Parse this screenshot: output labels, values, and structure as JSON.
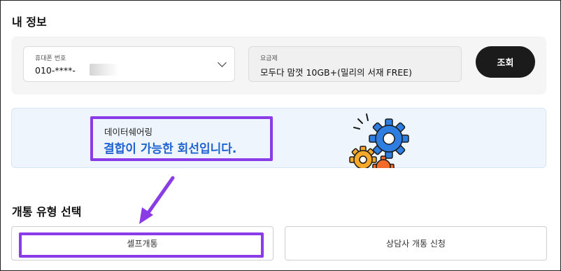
{
  "section_my_info": {
    "title": "내 정보"
  },
  "phone": {
    "label": "휴대폰 번호",
    "value": "010-****-"
  },
  "plan": {
    "label": "요금제",
    "value": "모두다 맘껏 10GB+(밀리의 서재 FREE)"
  },
  "query_button": {
    "label": "조회"
  },
  "banner": {
    "label": "데이터쉐어링",
    "title": "결합이 가능한 회선입니다."
  },
  "section_open_type": {
    "title": "개통 유형 선택"
  },
  "open_type_options": [
    {
      "label": "셀프개통",
      "selected": true
    },
    {
      "label": "상담사 개통 신청",
      "selected": false
    }
  ],
  "colors": {
    "accent_highlight": "#8a3ce6",
    "banner_text": "#1f63d2",
    "primary_button": "#1b1b1b"
  },
  "icons": [
    "chevron-down-icon",
    "gear-illustration-icon",
    "arrow-annotation-icon"
  ]
}
